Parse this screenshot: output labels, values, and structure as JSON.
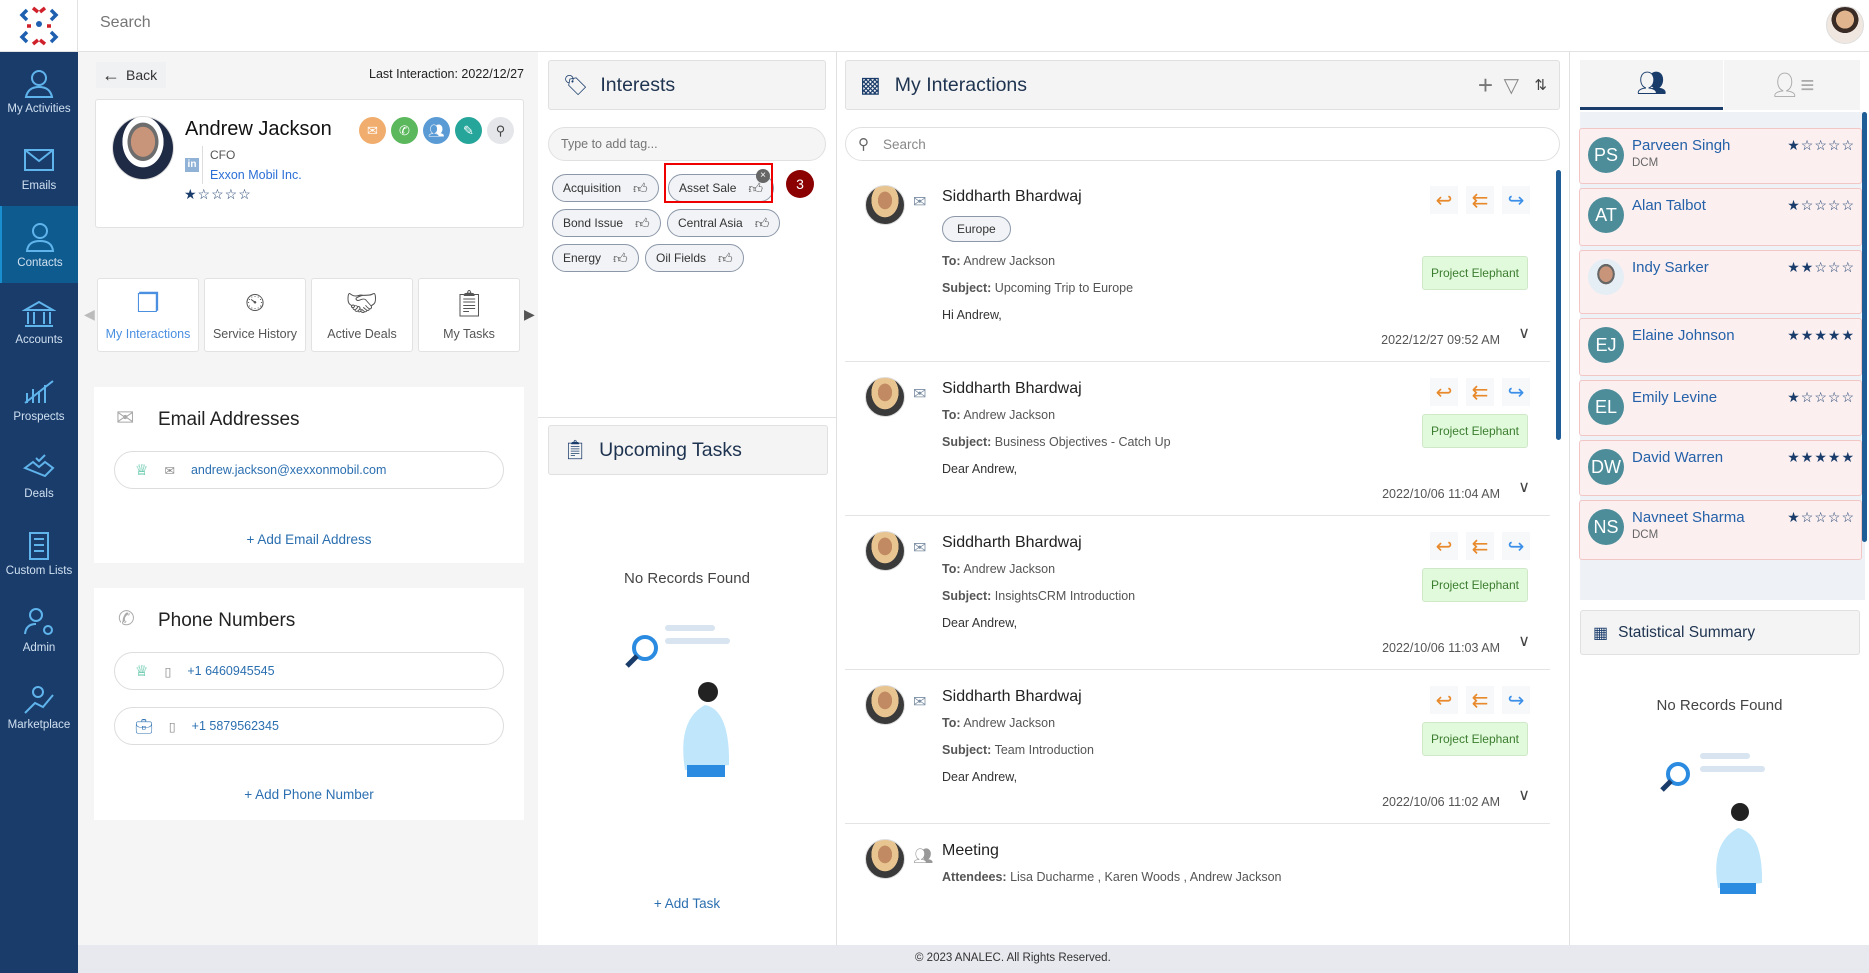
{
  "topbar": {
    "search_placeholder": "Search"
  },
  "sidebar": {
    "items": [
      {
        "label": "My Activities",
        "icon": "user-check-icon"
      },
      {
        "label": "Emails",
        "icon": "envelope-icon"
      },
      {
        "label": "Contacts",
        "icon": "user-icon",
        "active": true
      },
      {
        "label": "Accounts",
        "icon": "bank-icon"
      },
      {
        "label": "Prospects",
        "icon": "chart-gear-icon"
      },
      {
        "label": "Deals",
        "icon": "handshake-icon"
      },
      {
        "label": "Custom Lists",
        "icon": "clipboard-list-icon"
      },
      {
        "label": "Admin",
        "icon": "user-gear-icon"
      },
      {
        "label": "Marketplace",
        "icon": "user-growth-icon"
      }
    ]
  },
  "contact": {
    "back_label": "Back",
    "last_interaction": "Last Interaction: 2022/12/27",
    "name": "Andrew Jackson",
    "title": "CFO",
    "company": "Exxon Mobil Inc.",
    "rating": 1,
    "linkedin": "in",
    "actions": [
      {
        "icon": "email-icon",
        "color": "#f0ad6e"
      },
      {
        "icon": "phone-icon",
        "color": "#5cb85c"
      },
      {
        "icon": "meeting-icon",
        "color": "#5b9bd5"
      },
      {
        "icon": "note-icon",
        "color": "#26a69a"
      },
      {
        "icon": "search-icon",
        "color": "#e4e6e9"
      }
    ]
  },
  "tabs": [
    {
      "label": "My Interactions",
      "active": true
    },
    {
      "label": "Service History"
    },
    {
      "label": "Active Deals"
    },
    {
      "label": "My Tasks"
    }
  ],
  "emails": {
    "title": "Email Addresses",
    "items": [
      "andrew.jackson@xexxonmobil.com"
    ],
    "add_label": "+ Add Email Address"
  },
  "phones": {
    "title": "Phone Numbers",
    "items": [
      {
        "number": "+1 6460945545",
        "type": "primary"
      },
      {
        "number": "+1 5879562345",
        "type": "work"
      }
    ],
    "add_label": "+ Add Phone Number"
  },
  "interests": {
    "title": "Interests",
    "placeholder": "Type to add tag...",
    "tags": [
      "Acquisition",
      "Asset Sale",
      "Bond Issue",
      "Central Asia",
      "Energy",
      "Oil Fields"
    ],
    "highlight_badge": "3"
  },
  "tasks": {
    "title": "Upcoming Tasks",
    "empty": "No Records Found",
    "add_label": "+ Add Task"
  },
  "interactions": {
    "title": "My Interactions",
    "search_placeholder": "Search",
    "items": [
      {
        "name": "Siddharth Bhardwaj",
        "region": "Europe",
        "to": "Andrew Jackson",
        "subject": "Upcoming Trip to Europe",
        "body": "Hi Andrew,",
        "project": "Project Elephant",
        "date": "2022/12/27 09:52 AM"
      },
      {
        "name": "Siddharth Bhardwaj",
        "to": "Andrew Jackson",
        "subject": "Business Objectives - Catch Up",
        "body": "Dear Andrew,",
        "project": "Project Elephant",
        "date": "2022/10/06 11:04 AM"
      },
      {
        "name": "Siddharth Bhardwaj",
        "to": "Andrew Jackson",
        "subject": "InsightsCRM Introduction",
        "body": "Dear Andrew,",
        "project": "Project Elephant",
        "date": "2022/10/06 11:03 AM"
      },
      {
        "name": "Siddharth Bhardwaj",
        "to": "Andrew Jackson",
        "subject": "Team Introduction",
        "body": "Dear Andrew,",
        "project": "Project Elephant",
        "date": "2022/10/06 11:02 AM"
      },
      {
        "name": "Meeting",
        "attendees": "Lisa Ducharme , Karen Woods , Andrew Jackson",
        "type": "meeting"
      }
    ],
    "labels": {
      "to": "To:",
      "subject": "Subject:",
      "attendees": "Attendees:"
    }
  },
  "related": {
    "people": [
      {
        "initials": "PS",
        "name": "Parveen Singh",
        "role": "DCM",
        "rating": 1
      },
      {
        "initials": "AT",
        "name": "Alan Talbot",
        "rating": 1
      },
      {
        "initials": "",
        "name": "Indy Sarker",
        "rating": 2,
        "photo": true
      },
      {
        "initials": "EJ",
        "name": "Elaine Johnson",
        "rating": 5
      },
      {
        "initials": "EL",
        "name": "Emily Levine",
        "rating": 1
      },
      {
        "initials": "DW",
        "name": "David Warren",
        "rating": 5
      },
      {
        "initials": "NS",
        "name": "Navneet Sharma",
        "role": "DCM",
        "rating": 1
      }
    ],
    "stat_title": "Statistical Summary",
    "stat_empty": "No Records Found"
  },
  "footer": "© 2023 ANALEC. All Rights Reserved."
}
